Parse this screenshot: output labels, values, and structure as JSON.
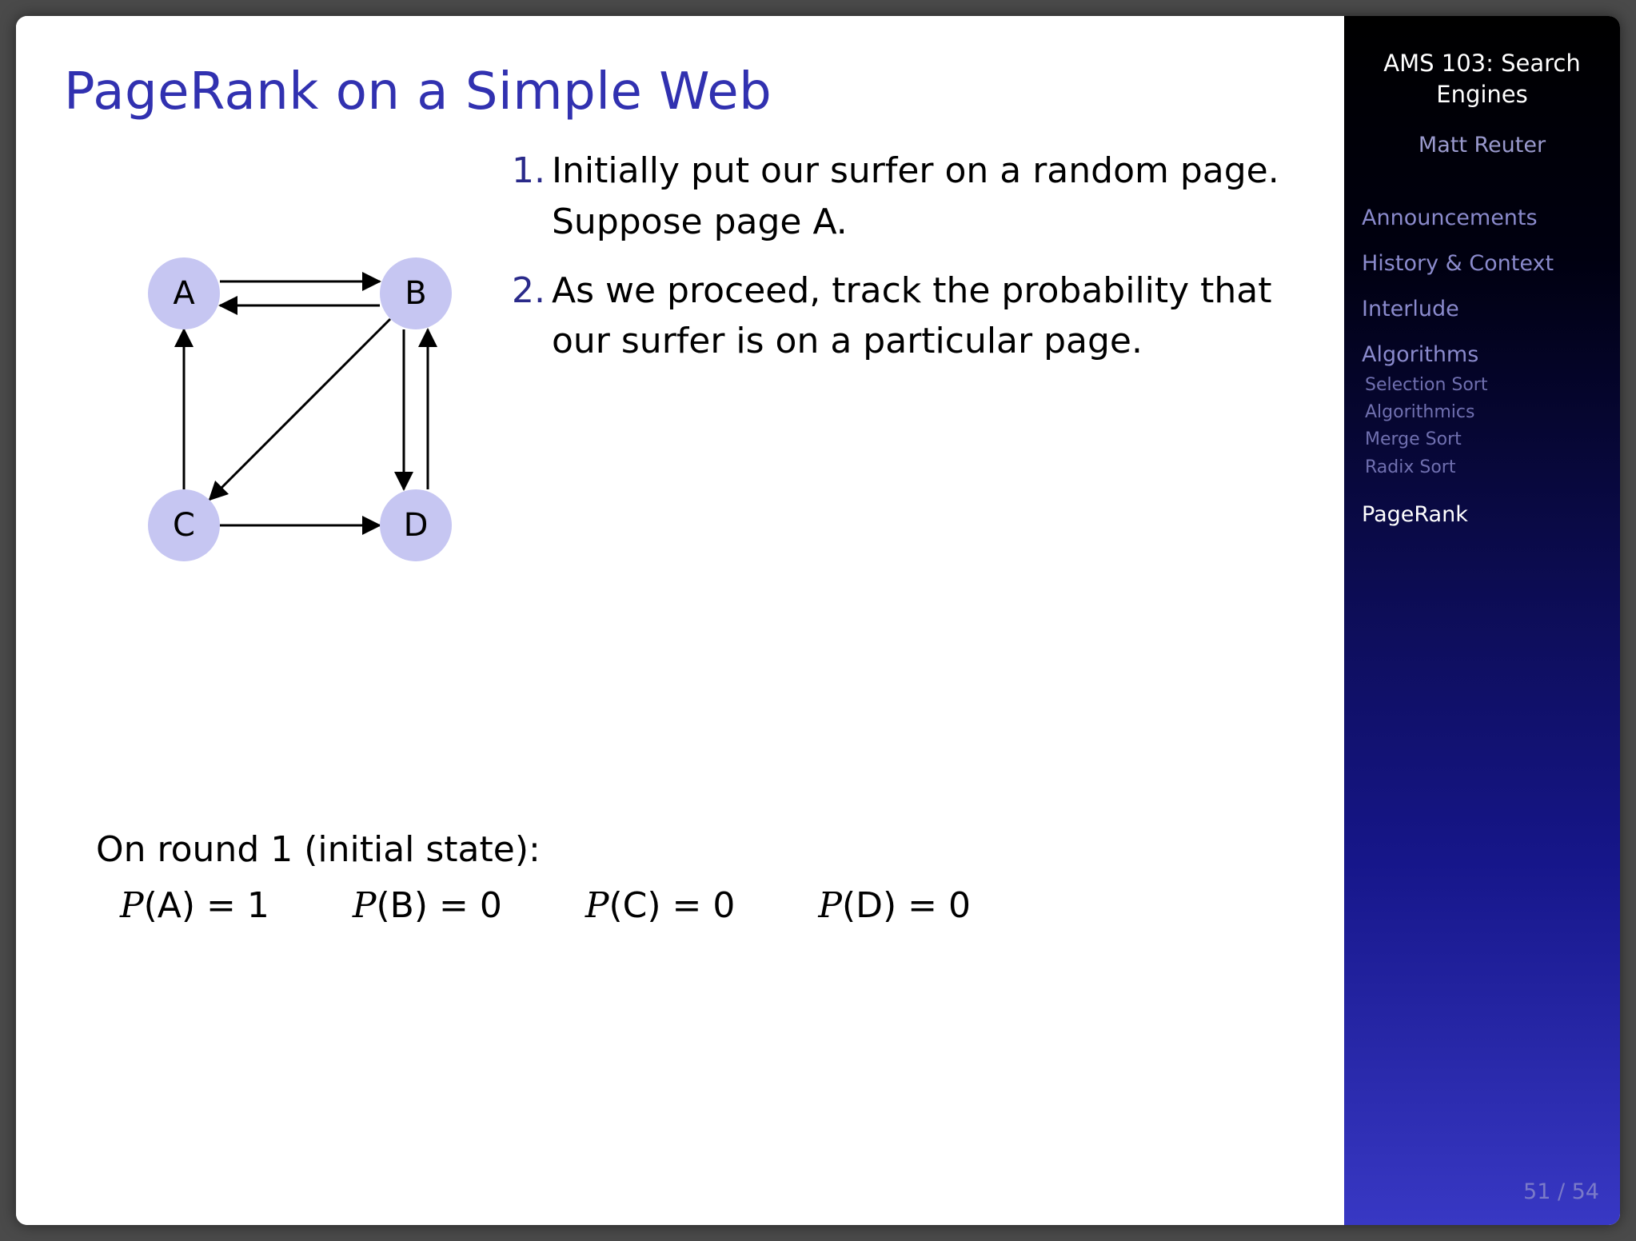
{
  "slide": {
    "title": "PageRank on a Simple Web",
    "steps": [
      {
        "num": "1.",
        "text": "Initially put our surfer on a random page. Suppose page A."
      },
      {
        "num": "2.",
        "text": "As we proceed, track the probability that our surfer is on a particular page."
      }
    ],
    "graph": {
      "nodes": [
        "A",
        "B",
        "C",
        "D"
      ],
      "edges": [
        [
          "A",
          "B"
        ],
        [
          "B",
          "A"
        ],
        [
          "B",
          "C"
        ],
        [
          "B",
          "D"
        ],
        [
          "C",
          "A"
        ],
        [
          "C",
          "D"
        ],
        [
          "D",
          "B"
        ]
      ]
    },
    "round_label": "On round 1 (initial state):",
    "probs": {
      "A": "1",
      "B": "0",
      "C": "0",
      "D": "0"
    }
  },
  "sidebar": {
    "course_line1": "AMS 103: Search",
    "course_line2": "Engines",
    "author": "Matt Reuter",
    "sections": {
      "announcements": "Announcements",
      "history": "History & Context",
      "interlude": "Interlude",
      "algorithms": "Algorithms",
      "subs": {
        "selection": "Selection Sort",
        "algorithmics": "Algorithmics",
        "merge": "Merge Sort",
        "radix": "Radix Sort"
      },
      "pagerank": "PageRank"
    },
    "pagenum": "51 / 54"
  }
}
